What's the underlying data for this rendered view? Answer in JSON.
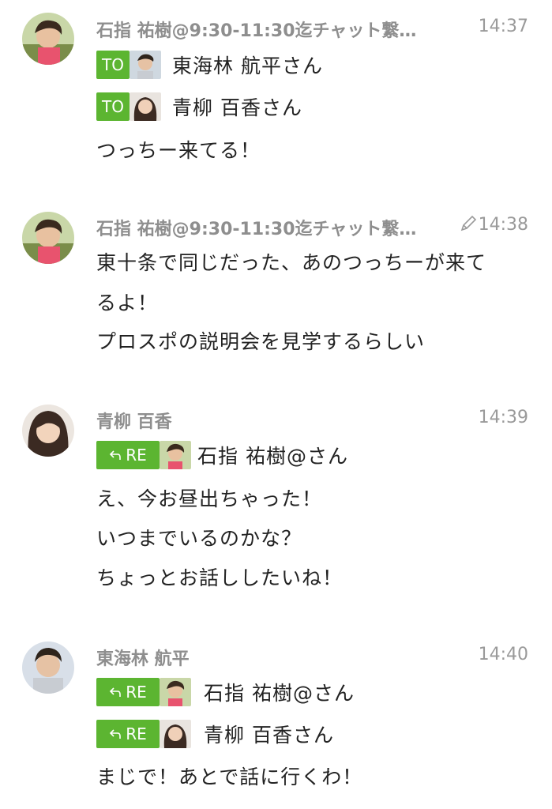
{
  "messages": [
    {
      "sender": "石指 祐樹@9:30-11:30迄チャット繋…",
      "time": "14:37",
      "edited": false,
      "mentions": [
        {
          "tag": "TO",
          "name": "東海林 航平さん"
        },
        {
          "tag": "TO",
          "name": "青柳 百香さん"
        }
      ],
      "lines": [
        "つっちー来てる！"
      ]
    },
    {
      "sender": "石指 祐樹@9:30-11:30迄チャット繋…",
      "time": "14:38",
      "edited": true,
      "mentions": [],
      "lines": [
        "東十条で同じだった、あのつっちーが来て",
        "るよ！",
        "プロスポの説明会を見学するらしい"
      ]
    },
    {
      "sender": "青柳 百香",
      "time": "14:39",
      "edited": false,
      "mentions": [
        {
          "tag": "RE",
          "name": "石指 祐樹@さん"
        }
      ],
      "lines": [
        "え、今お昼出ちゃった！",
        "いつまでいるのかな？",
        "ちょっとお話ししたいね！"
      ]
    },
    {
      "sender": "東海林 航平",
      "time": "14:40",
      "edited": false,
      "mentions": [
        {
          "tag": "RE",
          "name": "石指 祐樹@さん"
        },
        {
          "tag": "RE",
          "name": "青柳 百香さん"
        }
      ],
      "lines": [
        "まじで！あとで話に行くわ！"
      ]
    }
  ],
  "colors": {
    "tag_green": "#5cb531",
    "sender_gray": "#8e8e8e",
    "time_gray": "#9a9a9a",
    "text": "#222222"
  },
  "icons": {
    "reply": "reply-arrow-icon",
    "edited": "pencil-icon"
  }
}
